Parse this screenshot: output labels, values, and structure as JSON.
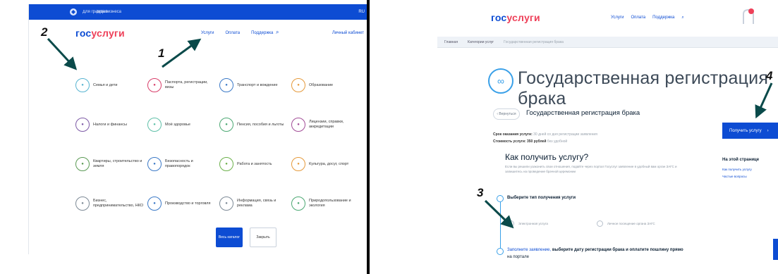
{
  "left": {
    "topbar": {
      "item1": "Для граждан",
      "item2": "Для бизнеса",
      "right": "RU"
    },
    "brand": {
      "part1": "гос",
      "part2": "услуги"
    },
    "nav": [
      "Услуги",
      "Оплата",
      "Поддержка"
    ],
    "search_glyph": "⌕",
    "cabinet": "Личный кабинет",
    "categories": [
      {
        "label": "Семья и дети",
        "color": "#58b4d1",
        "icon": "family-icon"
      },
      {
        "label": "Паспорта, регистрации, визы",
        "color": "#d83e6a",
        "icon": "passport-icon"
      },
      {
        "label": "Транспорт и вождение",
        "color": "#3b79c7",
        "icon": "transport-icon"
      },
      {
        "label": "Образование",
        "color": "#e59a3c",
        "icon": "education-icon"
      },
      {
        "label": "Налоги и финансы",
        "color": "#7d5aa6",
        "icon": "taxes-icon"
      },
      {
        "label": "Моё здоровье",
        "color": "#5fc0a8",
        "icon": "health-icon"
      },
      {
        "label": "Пенсия, пособия и льготы",
        "color": "#4ca873",
        "icon": "pension-icon"
      },
      {
        "label": "Лицензии, справки, аккредитации",
        "color": "#a24d97",
        "icon": "license-icon"
      },
      {
        "label": "Квартиры, строительство и земля",
        "color": "#5b9a54",
        "icon": "housing-icon"
      },
      {
        "label": "Безопасность и правопорядок",
        "color": "#3b79c7",
        "icon": "security-icon"
      },
      {
        "label": "Работа и занятость",
        "color": "#6bb04a",
        "icon": "work-icon"
      },
      {
        "label": "Культура, досуг, спорт",
        "color": "#e59a3c",
        "icon": "culture-icon"
      },
      {
        "label": "Бизнес, предпринимательство, НКО",
        "color": "#7d8a96",
        "icon": "business-icon"
      },
      {
        "label": "Производство и торговля",
        "color": "#3b79c7",
        "icon": "production-icon"
      },
      {
        "label": "Информация, связь и реклама",
        "color": "#7d8a96",
        "icon": "info-icon"
      },
      {
        "label": "Природопользование и экология",
        "color": "#4ca873",
        "icon": "ecology-icon"
      }
    ],
    "btn_all": "Весь каталог",
    "btn_hide": "Закрыть"
  },
  "right": {
    "brand": {
      "part1": "гос",
      "part2": "услуги"
    },
    "nav": [
      "Услуги",
      "Оплата",
      "Поддержка",
      "⌕"
    ],
    "breadcrumbs": [
      "Главная",
      "Категории услуг",
      "Государственная регистрация брака"
    ],
    "title": "Государственная регистрация брака",
    "back": "‹ Вернуться",
    "subtitle": "Государственная регистрация брака",
    "term_label": "Срок оказания услуги:",
    "term_value": "30 дней со дня регистрации заявления",
    "cost_label": "Стоимость услуги: 350 рублей",
    "cost_value": "без удобной",
    "how_title": "Как получить услугу?",
    "how_text": "Если вы решили узаконить свои отношения, подайте через портал Госуслуг заявление в удобный вам орган ЗАГС и запишитесь на проведение брачной церемонии",
    "step1_title": "Выберите тип получения услуги",
    "radio1": "Электронная услуга",
    "radio2": "Личное посещение органа ЗАГС",
    "step2_link": "Заполните заявление,",
    "step2_text": "выберите дату регистрации брака и оплатите пошлину прямо",
    "step2_more": "на портале",
    "get_btn": "Получить услугу",
    "get_btn_arrow": "›",
    "on_page": "На этой странице",
    "on_page_links": [
      "Как получить услугу",
      "Частые вопросы"
    ]
  },
  "annotations": [
    "1",
    "2",
    "3",
    "4"
  ]
}
